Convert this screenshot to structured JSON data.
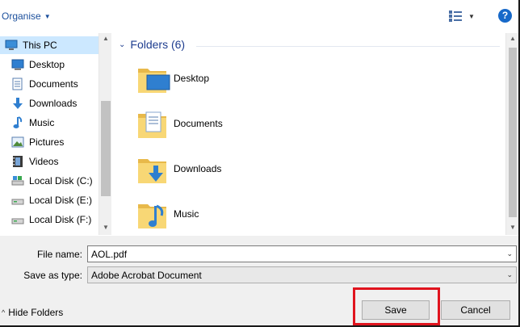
{
  "toolbar": {
    "organise_label": "Organise",
    "view_icon": "details-view-icon",
    "help_label": "?"
  },
  "nav": {
    "items": [
      {
        "label": "This PC",
        "icon": "pc-icon",
        "selected": true
      },
      {
        "label": "Desktop",
        "icon": "desktop-icon"
      },
      {
        "label": "Documents",
        "icon": "documents-icon"
      },
      {
        "label": "Downloads",
        "icon": "downloads-icon"
      },
      {
        "label": "Music",
        "icon": "music-icon"
      },
      {
        "label": "Pictures",
        "icon": "pictures-icon"
      },
      {
        "label": "Videos",
        "icon": "videos-icon"
      },
      {
        "label": "Local Disk (C:)",
        "icon": "drive-c-icon"
      },
      {
        "label": "Local Disk (E:)",
        "icon": "drive-icon"
      },
      {
        "label": "Local Disk (F:)",
        "icon": "drive-icon"
      }
    ]
  },
  "main": {
    "group_title": "Folders (6)",
    "folders": [
      {
        "label": "Desktop",
        "icon": "desktop-folder-icon"
      },
      {
        "label": "Documents",
        "icon": "documents-folder-icon"
      },
      {
        "label": "Downloads",
        "icon": "downloads-folder-icon"
      },
      {
        "label": "Music",
        "icon": "music-folder-icon"
      }
    ]
  },
  "form": {
    "file_name_label": "File name:",
    "file_name_value": "AOL.pdf",
    "save_type_label": "Save as type:",
    "save_type_value": "Adobe Acrobat Document",
    "hide_folders_label": "Hide Folders",
    "save_label": "Save",
    "cancel_label": "Cancel"
  },
  "colors": {
    "accent": "#1b4f9c",
    "selection": "#cce8ff",
    "highlight": "#e0141e",
    "folder": "#f8d775"
  }
}
